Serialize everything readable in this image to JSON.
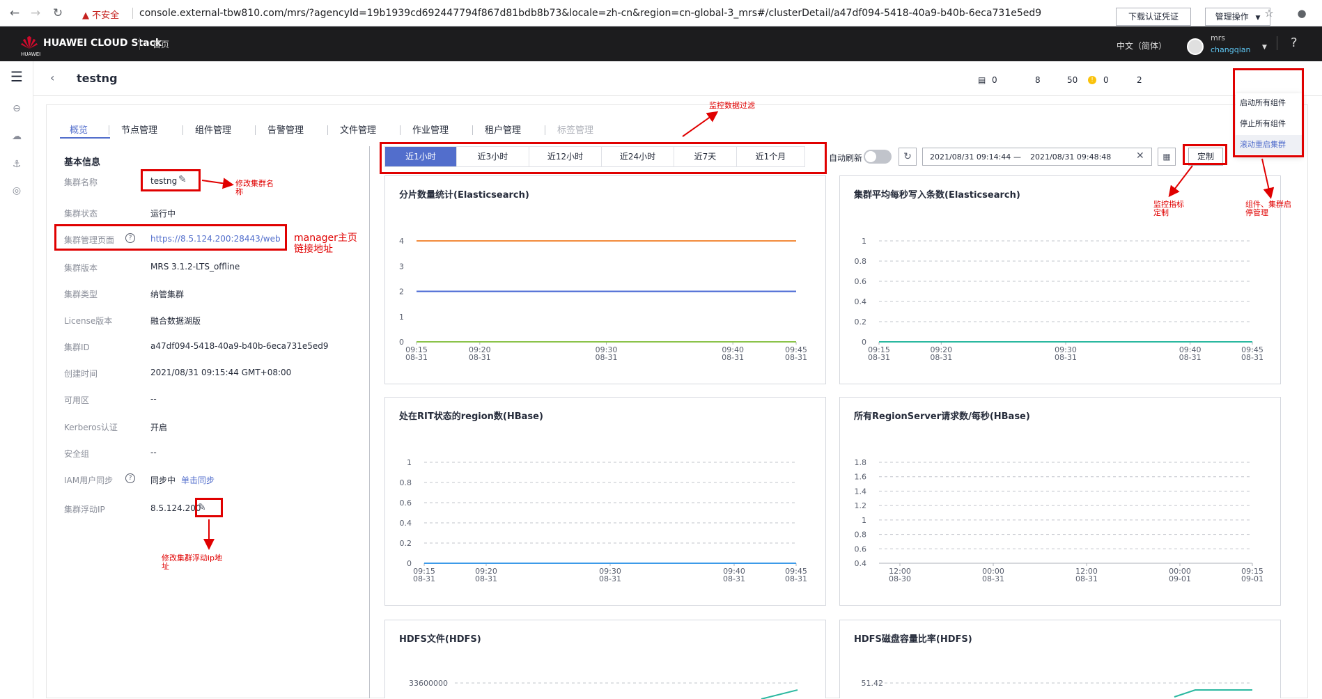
{
  "browser": {
    "warning": "不安全",
    "url": "console.external-tbw810.com/mrs/?agencyId=19b1939cd692447794f867d81bdb8b73&locale=zh-cn&region=cn-global-3_mrs#/clusterDetail/a47df094-5418-40a9-b40b-6eca731e5ed9"
  },
  "topnav": {
    "brand": "HUAWEI CLOUD Stack",
    "brand_sub": "HUAWEI",
    "home": "首页",
    "language": "中文（简体）",
    "user_top": "mrs",
    "user_name": "changqian",
    "help": "?"
  },
  "header": {
    "title": "testng",
    "stats": [
      "0",
      "8",
      "50",
      "0",
      "2"
    ],
    "download_button": "下载认证凭证",
    "manage_button": "管理操作"
  },
  "manage_menu": {
    "items": [
      "启动所有组件",
      "停止所有组件",
      "滚动重启集群"
    ]
  },
  "tabs": [
    "概览",
    "节点管理",
    "组件管理",
    "告警管理",
    "文件管理",
    "作业管理",
    "租户管理",
    "标签管理"
  ],
  "info": {
    "title": "基本信息",
    "rows": [
      {
        "label": "集群名称",
        "value": "testng"
      },
      {
        "label": "集群状态",
        "value": "运行中"
      },
      {
        "label": "集群管理页面",
        "value": "https://8.5.124.200:28443/web"
      },
      {
        "label": "集群版本",
        "value": "MRS 3.1.2-LTS_offline"
      },
      {
        "label": "集群类型",
        "value": "纳管集群"
      },
      {
        "label": "License版本",
        "value": "融合数据湖版"
      },
      {
        "label": "集群ID",
        "value": "a47df094-5418-40a9-b40b-6eca731e5ed9"
      },
      {
        "label": "创建时间",
        "value": "2021/08/31 09:15:44 GMT+08:00"
      },
      {
        "label": "可用区",
        "value": "--"
      },
      {
        "label": "Kerberos认证",
        "value": "开启"
      },
      {
        "label": "安全组",
        "value": "--"
      },
      {
        "label": "IAM用户同步",
        "value": "同步中"
      },
      {
        "label": "集群浮动IP",
        "value": "8.5.124.200"
      }
    ],
    "sync_link": "单击同步"
  },
  "time_filter": {
    "buttons": [
      "近1小时",
      "近3小时",
      "近12小时",
      "近24小时",
      "近7天",
      "近1个月"
    ],
    "selected": "近1小时",
    "auto_refresh": "自动刷新",
    "auto_refresh_on": false,
    "start": "2021/08/31 09:14:44",
    "dash": "—",
    "end": "2021/08/31 09:48:48",
    "custom": "定制"
  },
  "annotations": {
    "filter": "监控数据过滤",
    "rename_1": "修改集群名",
    "rename_2": "称",
    "manager_1": "manager主页",
    "manager_2": "链接地址",
    "ip_1": "修改集群浮动ip地",
    "ip_2": "址",
    "custom_1": "监控指标",
    "custom_2": "定制",
    "ops_1": "组件、集群启",
    "ops_2": "停管理"
  },
  "chart_data": [
    {
      "type": "line",
      "title": "分片数量统计(Elasticsearch)",
      "x": [
        "09:15\n08-31",
        "09:20\n08-31",
        "09:30\n08-31",
        "09:40\n08-31",
        "09:45\n08-31"
      ],
      "x_minutes": [
        15,
        20,
        30,
        40,
        45
      ],
      "yticks": [
        0,
        1,
        2,
        3,
        4
      ],
      "ylim": [
        0,
        4
      ],
      "series": [
        {
          "color": "#f28b3c",
          "values": [
            4,
            4
          ]
        },
        {
          "color": "#4a69d4",
          "values": [
            2,
            2
          ]
        },
        {
          "color": "#8bc34a",
          "values": [
            0,
            0
          ]
        }
      ]
    },
    {
      "type": "line",
      "title": "集群平均每秒写入条数(Elasticsearch)",
      "x": [
        "09:15\n08-31",
        "09:20\n08-31",
        "09:30\n08-31",
        "09:40\n08-31",
        "09:45\n08-31"
      ],
      "yticks": [
        0,
        0.2,
        0.4,
        0.6,
        0.8,
        1
      ],
      "ylim": [
        0,
        1
      ],
      "grid": "dashed",
      "series": [
        {
          "color": "#2bb8a0",
          "values": [
            0,
            0
          ]
        }
      ]
    },
    {
      "type": "line",
      "title": "处在RIT状态的region数(HBase)",
      "x": [
        "09:15\n08-31",
        "09:20\n08-31",
        "09:30\n08-31",
        "09:40\n08-31",
        "09:45\n08-31"
      ],
      "yticks": [
        0,
        0.2,
        0.4,
        0.6,
        0.8,
        1
      ],
      "ylim": [
        0,
        1
      ],
      "grid": "dashed",
      "series": [
        {
          "color": "#3d9be9",
          "values": [
            0,
            0
          ]
        }
      ]
    },
    {
      "type": "line",
      "title": "所有RegionServer请求数/每秒(HBase)",
      "x": [
        "12:00\n08-30",
        "00:00\n08-31",
        "12:00\n08-31",
        "00:00\n09-01",
        "09:15\n09-01"
      ],
      "yticks": [
        0.4,
        0.6,
        0.8,
        1,
        1.2,
        1.4,
        1.6,
        1.8
      ],
      "ylim": [
        0.4,
        1.8
      ],
      "grid": "dashed",
      "series": []
    },
    {
      "type": "line",
      "title": "HDFS文件(HDFS)",
      "yticks": [
        33600000
      ],
      "series": [
        {
          "color": "#2bb8a0"
        }
      ]
    },
    {
      "type": "line",
      "title": "HDFS磁盘容量比率(HDFS)",
      "yticks": [
        51.42
      ],
      "series": [
        {
          "color": "#2bb8a0"
        }
      ]
    }
  ]
}
